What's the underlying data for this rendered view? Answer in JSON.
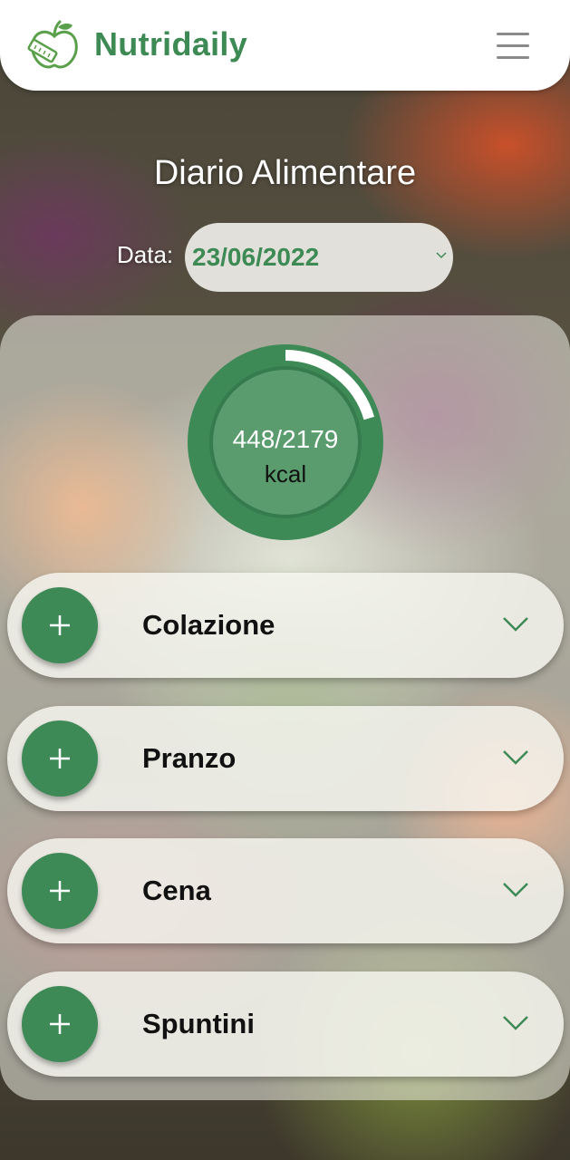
{
  "header": {
    "brand": "Nutridaily",
    "logo_icon": "apple-measuring-tape-icon",
    "menu_icon": "hamburger-menu-icon"
  },
  "page": {
    "title": "Diario Alimentare",
    "date_label": "Data:",
    "date_value": "23/06/2022"
  },
  "calories": {
    "text": "448/2179",
    "unit": "kcal",
    "consumed": 448,
    "goal": 2179
  },
  "meals": [
    {
      "label": "Colazione",
      "add_icon": "plus-icon",
      "expand_icon": "chevron-down-icon"
    },
    {
      "label": "Pranzo",
      "add_icon": "plus-icon",
      "expand_icon": "chevron-down-icon"
    },
    {
      "label": "Cena",
      "add_icon": "plus-icon",
      "expand_icon": "chevron-down-icon"
    },
    {
      "label": "Spuntini",
      "add_icon": "plus-icon",
      "expand_icon": "chevron-down-icon"
    }
  ],
  "colors": {
    "brand_green": "#3d8a55",
    "ring_green": "#3e8a57",
    "ring_inner": "#5a9c6e"
  }
}
